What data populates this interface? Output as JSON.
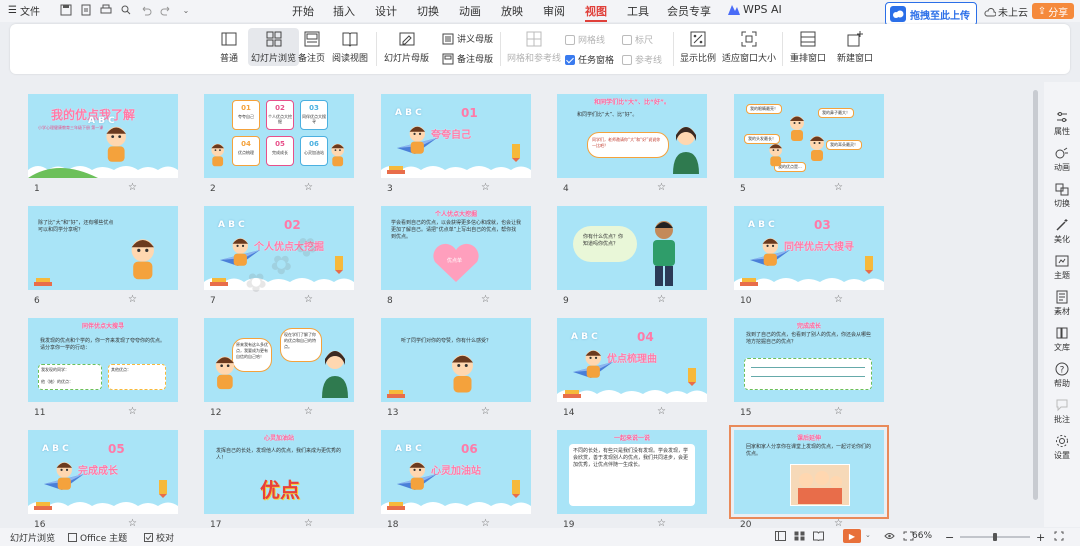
{
  "menubar": {
    "file_label": "文件",
    "tabs": [
      "开始",
      "插入",
      "设计",
      "切换",
      "动画",
      "放映",
      "审阅",
      "视图",
      "工具",
      "会员专享"
    ],
    "active_tab": "视图",
    "wps_ai_label": "WPS AI",
    "upload_label": "拖拽至此上传",
    "cloud_label": "未上云",
    "share_label": "分享"
  },
  "ribbon": {
    "normal": "普通",
    "slide_browse": "幻灯片浏览",
    "notes_page": "备注页",
    "reading_view": "阅读视图",
    "slide_master": "幻灯片母版",
    "handout_master": "讲义母版",
    "notes_master": "备注母版",
    "grid_guides": "网格和参考线",
    "gridlines": "网格线",
    "ruler": "标尺",
    "guides": "参考线",
    "task_pane": "任务窗格",
    "zoom_ratio": "显示比例",
    "fit_window": "适应窗口大小",
    "arrange_window": "重排窗口",
    "new_window": "新建窗口"
  },
  "slides": [
    {
      "num": "1",
      "title": "我的优点我了解",
      "sub": "小学心理健康教育三年级下册 第一课"
    },
    {
      "num": "2",
      "toc": [
        {
          "n": "01",
          "t": "夸夸自己"
        },
        {
          "n": "02",
          "t": "个人优点大挖掘"
        },
        {
          "n": "03",
          "t": "同伴优点大搜寻"
        },
        {
          "n": "04",
          "t": "优点梳理"
        },
        {
          "n": "05",
          "t": "完成成长"
        },
        {
          "n": "06",
          "t": "心灵加油站"
        }
      ]
    },
    {
      "num": "3",
      "secnum": "01",
      "title": "夸夸自己"
    },
    {
      "num": "4",
      "text": "和同学们比“大”、比“好”。",
      "bubble": "同学们，老师邀请你“大”和“好”说说你一比吧？"
    },
    {
      "num": "5",
      "b1": "我的眼睛最亮！",
      "b2": "我的鼻子最大！",
      "b3": "我的耳朵最灵！",
      "b4": "我的头发最长！",
      "b5": "我的优点是..."
    },
    {
      "num": "6",
      "text": "除了比“大”和“好”，还有哪些优点可以和同学分享呢？"
    },
    {
      "num": "7",
      "secnum": "02",
      "title": "个人优点大挖掘"
    },
    {
      "num": "8",
      "header": "个人优点大挖掘",
      "text": "学会看到自己的优点，以会获得更多信心和成就，也会让我更加了解自己。请把“优点单”上写出自己的优点，帮你找到优点。",
      "heart": "优点单"
    },
    {
      "num": "9",
      "cloud": "你有什么优点？你知道吗你优点？"
    },
    {
      "num": "10",
      "secnum": "03",
      "title": "同伴优点大搜寻"
    },
    {
      "num": "11",
      "header": "同伴优点大搜寻",
      "text": "我发现的优点和个学的，你一齐来发现了夸夸你的优点。请分享你一学的行动：",
      "f1": "我发现的同学：",
      "f2": "其他优点：",
      "f3": "他（她）的优点："
    },
    {
      "num": "12",
      "b1": "原来我有这么多优点，我要成为更有自信的自己哈！",
      "b2": "现在学们了解了你的优点和自己的特点。"
    },
    {
      "num": "13",
      "text": "听了同学们对你的夸赞，你有什么感受？"
    },
    {
      "num": "14",
      "secnum": "04",
      "title": "优点梳理曲"
    },
    {
      "num": "15",
      "header": "完成成长",
      "text": "找到了自己的优点，也看到了别人的优点，你还会从哪些地方挖掘自己的优点？"
    },
    {
      "num": "16",
      "secnum": "05",
      "title": "完成成长"
    },
    {
      "num": "17",
      "header": "心灵加油站",
      "text": "发挥自己的长处，发现他人的优点，我们来成为更优秀的人！",
      "badge": "优点"
    },
    {
      "num": "18",
      "secnum": "06",
      "title": "心灵加油站"
    },
    {
      "num": "19",
      "header": "一起来说一说",
      "text": "不同的长处，有些只是我们没有发现。学会发现，学会欣赏，善于发现别人的优点，我们共同进步，会更加优秀，让优点伴随一生成长。"
    },
    {
      "num": "20",
      "header": "课后延伸",
      "text": "回家和家人分享你在课堂上发现的优点，一起讨论你们的优点。"
    }
  ],
  "rightpanel": [
    "属性",
    "动画",
    "切换",
    "美化",
    "主题",
    "素材",
    "文库",
    "帮助",
    "批注",
    "设置"
  ],
  "statusbar": {
    "view": "幻灯片浏览",
    "theme": "Office 主题",
    "proofread": "校对",
    "zoom": "66%"
  },
  "colors": {
    "accent": "#e0403a",
    "slide_bg": "#a9e4f7",
    "title_pink": "#ff7aa8",
    "share_orange": "#f58a3c",
    "upload_blue": "#2b6fe8"
  }
}
